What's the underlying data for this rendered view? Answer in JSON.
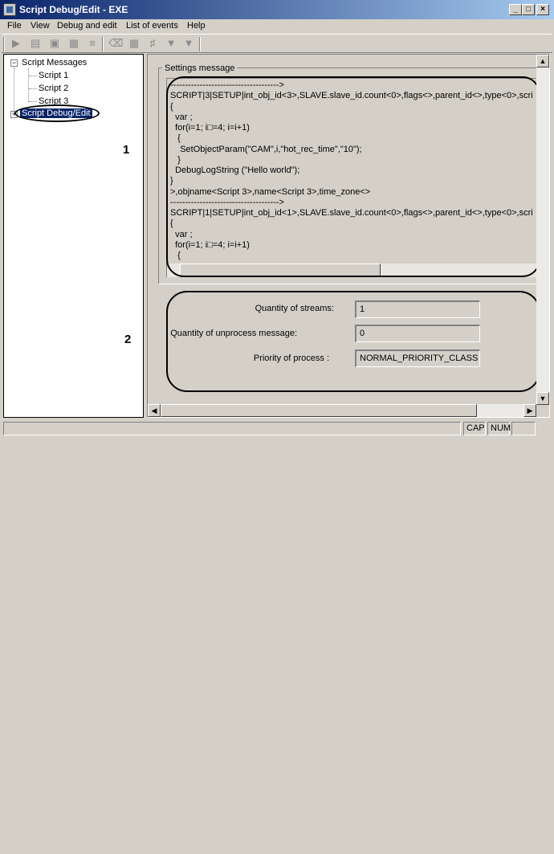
{
  "window": {
    "title": "Script Debug/Edit - EXE",
    "controls": [
      "_",
      "□",
      "×"
    ]
  },
  "menu": [
    "File",
    "View",
    "Debug and edit",
    "List of events",
    "Help"
  ],
  "toolbar": {
    "icons": [
      "run-icon",
      "step-icon",
      "save-icon",
      "compile-icon",
      "list-icon",
      "erase-icon",
      "grid-icon",
      "filter-icon",
      "funnel-icon",
      "funnel-edit-icon"
    ]
  },
  "tree": {
    "root": "Script Messages",
    "root_expander": "−",
    "children": [
      "Script 1",
      "Script 2",
      "Script 3"
    ],
    "second": "Script Debug/Edit",
    "second_expander": "+"
  },
  "settings": {
    "label": "Settings message",
    "lines": [
      "------------------------------------->",
      "SCRIPT|3|SETUP|int_obj_id<3>,SLAVE.slave_id.count<0>,flags<>,parent_id<>,type<0>,scri",
      "{",
      "  var ;",
      "  for(i=1; i□=4; i=i+1)",
      "   {",
      "    SetObjectParam(\"CAM\",i,\"hot_rec_time\",\"10\");",
      "   }",
      "  DebugLogString (\"Hello world\");",
      "}",
      ">,objname<Script 3>,name<Script 3>,time_zone<>",
      "------------------------------------->",
      "SCRIPT|1|SETUP|int_obj_id<1>,SLAVE.slave_id.count<0>,flags<>,parent_id<>,type<0>,scri",
      "{",
      "  var ;",
      "  for(i=1; i□=4; i=i+1)",
      "   {"
    ]
  },
  "stats": {
    "streams_label": "Quantity of streams:",
    "streams_value": "1",
    "unprocess_label": "Quantity of unprocess message:",
    "unprocess_value": "0",
    "priority_label": "Priority of process :",
    "priority_value": "NORMAL_PRIORITY_CLASS"
  },
  "markers": {
    "one": "1",
    "two": "2"
  },
  "status": {
    "cap": "CAP",
    "num": "NUM"
  },
  "colors": {
    "titlebar_start": "#0a246a",
    "titlebar_end": "#a6caf0",
    "selection": "#0a246a",
    "face": "#d4d0c8"
  }
}
